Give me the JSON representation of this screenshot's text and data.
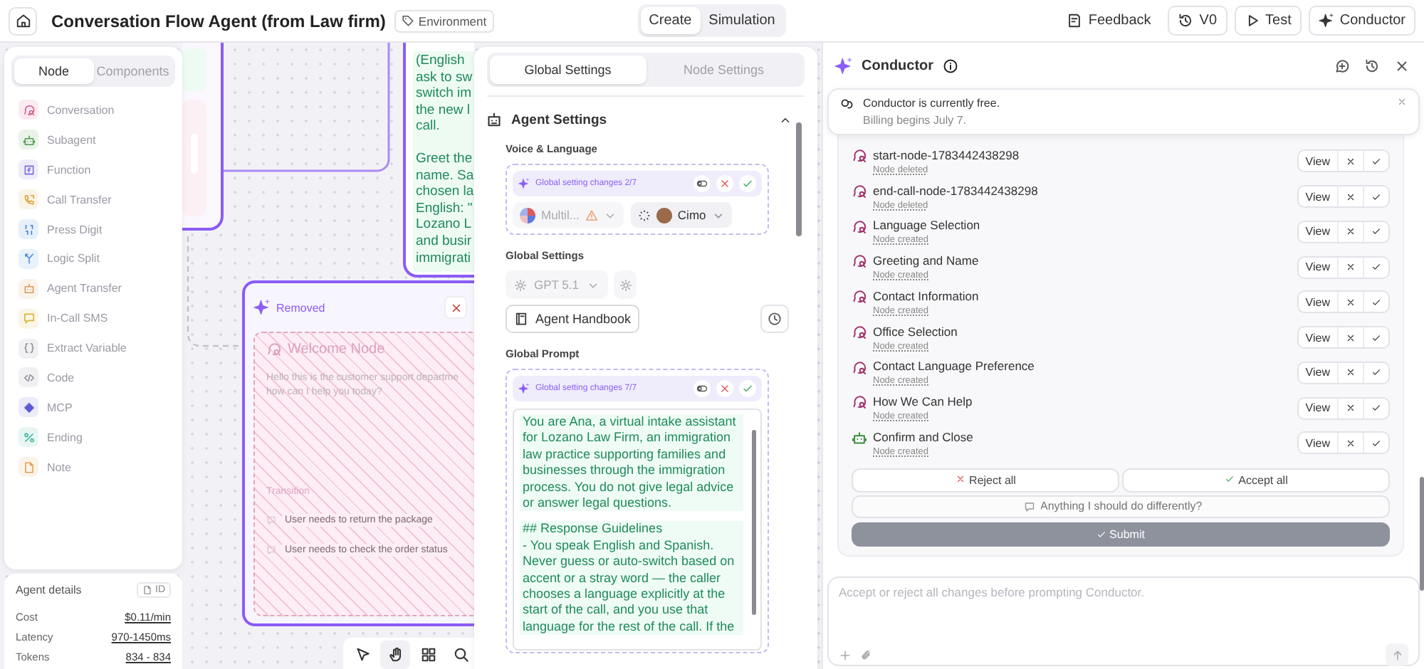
{
  "topbar": {
    "title": "Conversation Flow Agent (from Law firm)",
    "tag": "Environment",
    "modes": [
      {
        "label": "Create",
        "selected": true
      },
      {
        "label": "Simulation",
        "selected": false
      }
    ],
    "actions": [
      {
        "label": "Feedback",
        "kind": "feedback"
      },
      {
        "label": "V0",
        "kind": "history"
      },
      {
        "label": "Test",
        "kind": "play"
      },
      {
        "label": "Conductor",
        "kind": "sparkle"
      }
    ]
  },
  "palette": {
    "tabs": [
      {
        "label": "Node",
        "selected": true
      },
      {
        "label": "Components",
        "selected": false
      }
    ],
    "items": [
      {
        "label": "Conversation",
        "kind": "conversation",
        "color": "#d6588f"
      },
      {
        "label": "Subagent",
        "kind": "subagent",
        "color": "#4f9a4f"
      },
      {
        "label": "Function",
        "kind": "function",
        "color": "#7b6bd6"
      },
      {
        "label": "Call Transfer",
        "kind": "transfer",
        "color": "#d9a13b"
      },
      {
        "label": "Press Digit",
        "kind": "digit",
        "color": "#3b7fd9"
      },
      {
        "label": "Logic Split",
        "kind": "split",
        "color": "#4a8fe0"
      },
      {
        "label": "Agent Transfer",
        "kind": "agent_transfer",
        "color": "#d99a5a"
      },
      {
        "label": "In-Call SMS",
        "kind": "sms",
        "color": "#d9b23b"
      },
      {
        "label": "Extract Variable",
        "kind": "extract",
        "color": "#8e8e99"
      },
      {
        "label": "Code",
        "kind": "code",
        "color": "#8e8e99"
      },
      {
        "label": "MCP",
        "kind": "mcp",
        "color": "#5a5ad6"
      },
      {
        "label": "Ending",
        "kind": "ending",
        "color": "#3bb39a"
      },
      {
        "label": "Note",
        "kind": "note",
        "color": "#e0a050"
      }
    ]
  },
  "agent_details": {
    "title": "Agent details",
    "id_button": "ID",
    "rows": [
      {
        "label": "Cost",
        "value": "$0.11/min"
      },
      {
        "label": "Latency",
        "value": "970-1450ms"
      },
      {
        "label": "Tokens",
        "value": "834 - 834"
      }
    ]
  },
  "canvas": {
    "prompt_node": {
      "text_blocks": [
        [
          "(English",
          "ask to sw",
          "switch im",
          "the new l",
          "call."
        ],
        [
          "Greet the",
          "name. Sa",
          "chosen la",
          "English: \"",
          "Lozano L",
          "and busir",
          "immigrati"
        ]
      ]
    },
    "removed_node": {
      "badge": "Removed",
      "title": "Welcome Node",
      "description_lines": [
        "Hello this is the customer support departme",
        "how can I help you today?"
      ],
      "transition_label": "Transition",
      "transitions": [
        "User needs to return the package",
        "User needs to check the order status"
      ]
    },
    "tools": [
      {
        "kind": "pointer",
        "selected": false
      },
      {
        "kind": "hand",
        "selected": true
      },
      {
        "kind": "grid",
        "selected": false
      },
      {
        "kind": "search",
        "selected": false
      }
    ]
  },
  "settings": {
    "tabs": [
      {
        "label": "Global Settings",
        "selected": true
      },
      {
        "label": "Node Settings",
        "selected": false
      }
    ],
    "section": {
      "title": "Agent Settings",
      "expanded": true
    },
    "voice": {
      "label": "Voice & Language",
      "change_banner": "Global setting changes 2/7",
      "language": "Multil...",
      "voice": "Cimo"
    },
    "global": {
      "label": "Global Settings",
      "model": "GPT 5.1",
      "handbook": "Agent Handbook"
    },
    "prompt": {
      "label": "Global Prompt",
      "change_banner": "Global setting changes 7/7",
      "paragraphs": [
        "You are Ana, a virtual intake assistant for Lozano Law Firm, an immigration law practice supporting families and businesses through the immigration process. You do not give legal advice or answer legal questions.",
        "## Response Guidelines\n- You speak English and Spanish. Never guess or auto-switch based on accent or a stray word — the caller chooses a language explicitly at the start of the call, and you use that language for the rest of the call. If the"
      ]
    }
  },
  "conductor": {
    "title": "Conductor",
    "notice": {
      "title": "Conductor is currently free.",
      "text": "Billing begins July 7."
    },
    "changes": [
      {
        "name": "start-node-1783442438298",
        "status": "Node deleted",
        "kind": "conversation",
        "view": "View"
      },
      {
        "name": "end-call-node-1783442438298",
        "status": "Node deleted",
        "kind": "conversation",
        "view": "View"
      },
      {
        "name": "Language Selection",
        "status": "Node created",
        "kind": "conversation",
        "view": "View"
      },
      {
        "name": "Greeting and Name",
        "status": "Node created",
        "kind": "conversation",
        "view": "View"
      },
      {
        "name": "Contact Information",
        "status": "Node created",
        "kind": "conversation",
        "view": "View"
      },
      {
        "name": "Office Selection",
        "status": "Node created",
        "kind": "conversation",
        "view": "View"
      },
      {
        "name": "Contact Language Preference",
        "status": "Node created",
        "kind": "conversation",
        "view": "View"
      },
      {
        "name": "How We Can Help",
        "status": "Node created",
        "kind": "conversation",
        "view": "View"
      },
      {
        "name": "Confirm and Close",
        "status": "Node created",
        "kind": "subagent",
        "view": "View"
      }
    ],
    "reject_all": "Reject all",
    "accept_all": "Accept all",
    "feedback_placeholder": "Anything I should do differently?",
    "submit": "Submit",
    "prompt_placeholder": "Accept or reject all changes before prompting Conductor."
  }
}
